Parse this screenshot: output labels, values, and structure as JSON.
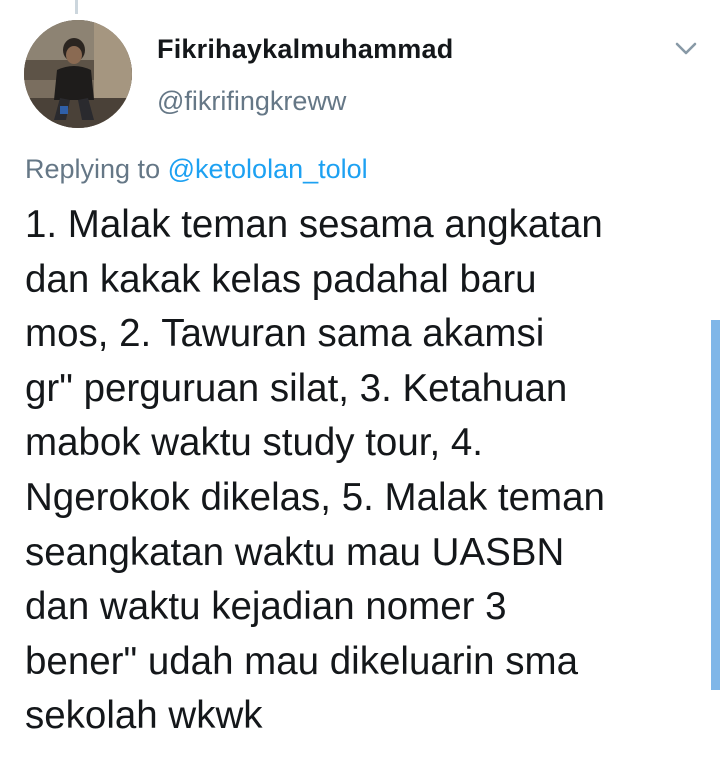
{
  "tweet": {
    "display_name": "Fikrihaykalmuhammad",
    "handle": "@fikrifingkreww",
    "replying_prefix": "Replying to",
    "replying_to": "@ketololan_tolol",
    "text": "1. Malak teman sesama angkatan\ndan kakak kelas padahal baru\nmos, 2. Tawuran sama akamsi\ngr\" perguruan silat, 3. Ketahuan\nmabok waktu study tour, 4.\nNgerokok dikelas, 5. Malak teman\nseangkatan waktu mau UASBN\ndan waktu kejadian nomer 3\nbener\" udah mau dikeluarin sma\nsekolah wkwk"
  },
  "icons": {
    "avatar": "profile-photo",
    "menu": "chevron-down-icon"
  },
  "colors": {
    "text": "#14171a",
    "secondary": "#657786",
    "accent": "#1da1f2",
    "scrollbar": "#7fb6e8"
  }
}
